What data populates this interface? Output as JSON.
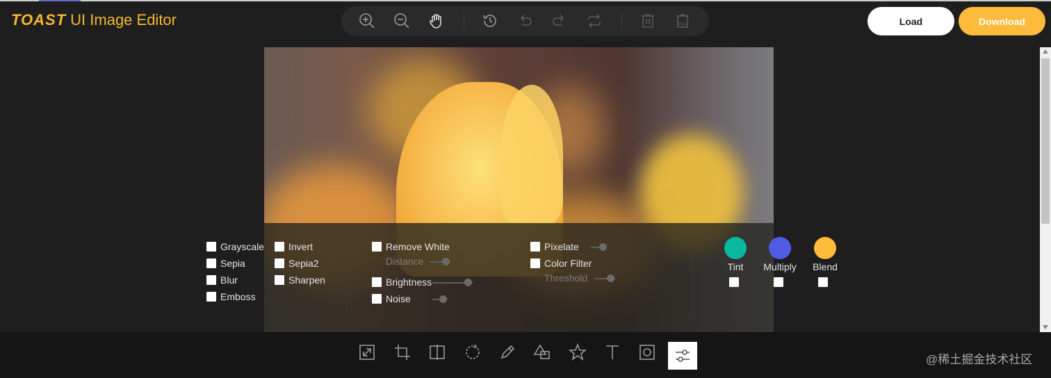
{
  "app": {
    "logo_brand": "TOAST",
    "logo_sub": "UI Image Editor"
  },
  "header": {
    "load_label": "Load",
    "download_label": "Download"
  },
  "top_menu": [
    "zoom-in-icon",
    "zoom-out-icon",
    "hand-icon",
    "history-icon",
    "undo-icon",
    "redo-icon",
    "reset-icon",
    "delete-icon",
    "delete-all-icon"
  ],
  "filters": {
    "col1": [
      "Grayscale",
      "Sepia",
      "Blur",
      "Emboss"
    ],
    "col2": [
      "Invert",
      "Sepia2",
      "Sharpen"
    ],
    "remove_white": "Remove White",
    "distance": "Distance",
    "brightness": "Brightness",
    "noise": "Noise",
    "pixelate": "Pixelate",
    "color_filter": "Color Filter",
    "threshold": "Threshold",
    "swatches": [
      {
        "label": "Tint",
        "color": "#08b99e"
      },
      {
        "label": "Multiply",
        "color": "#515ce6"
      },
      {
        "label": "Blend",
        "color": "#fdba3b"
      }
    ]
  },
  "bottom_tools": [
    "resize-icon",
    "crop-icon",
    "flip-icon",
    "rotate-icon",
    "draw-icon",
    "shape-icon",
    "icon-tool-icon",
    "text-icon",
    "mask-icon",
    "filter-icon"
  ],
  "active_tool": "filter-icon",
  "watermark": "@稀土掘金技术社区",
  "colors": {
    "accent": "#fdba3b",
    "logo": "#f5b832"
  }
}
